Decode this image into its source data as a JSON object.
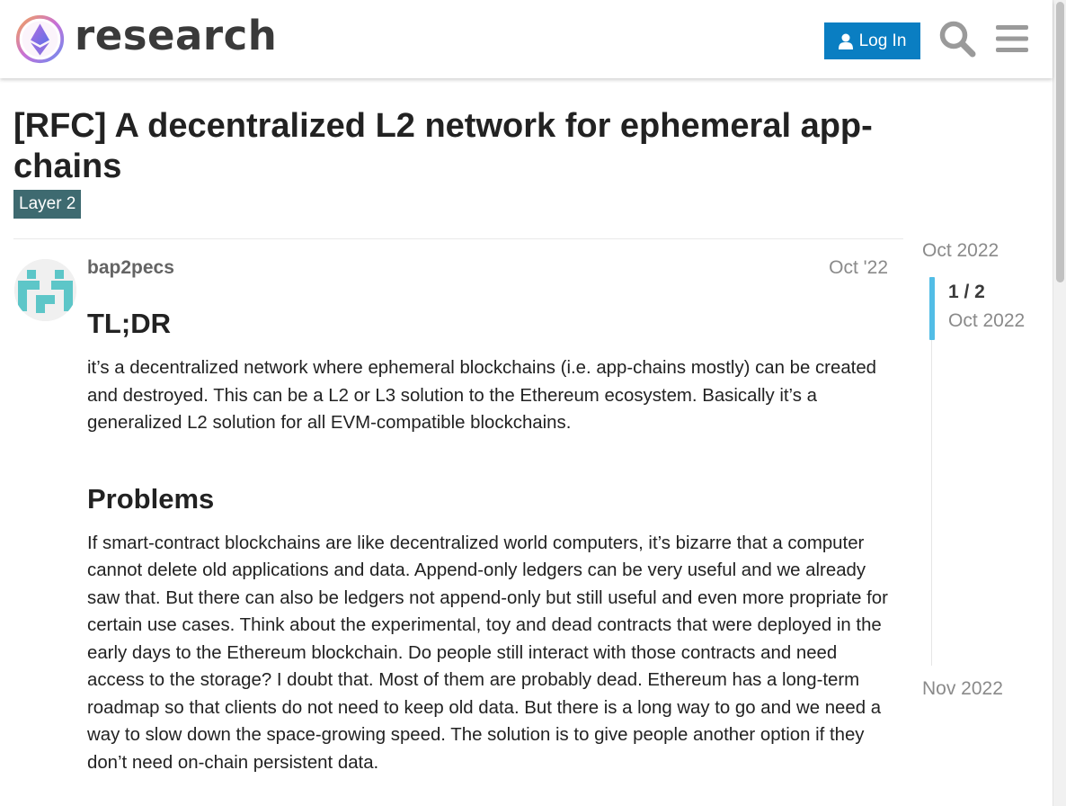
{
  "header": {
    "logo_text": "research",
    "login_label": "Log In",
    "icons": [
      "ethereum-logo",
      "user-icon",
      "search-icon",
      "hamburger-menu-icon"
    ],
    "accent_color": "#0a7ec2"
  },
  "topic": {
    "title": "[RFC] A decentralized L2 network for ephemeral app-chains",
    "category": "Layer 2",
    "category_color": "#3e6a70"
  },
  "post": {
    "author": "bap2pecs",
    "date": "Oct '22",
    "heading_tldr": "TL;DR",
    "tldr_text": "it’s a decentralized network where ephemeral blockchains (i.e. app-chains mostly) can be created and destroyed. This can be a L2 or L3 solution to the Ethereum ecosystem. Basically it’s a generalized L2 solution for all EVM-compatible blockchains.",
    "heading_problems": "Problems",
    "problems_text": "If smart-contract blockchains are like decentralized world computers, it’s bizarre that a computer cannot delete old applications and data. Append-only ledgers can be very useful and we already saw that. But there can also be ledgers not append-only but still useful and even more propriate for certain use cases. Think about the experimental, toy and dead contracts that were deployed in the early days to the Ethereum blockchain. Do people still interact with those contracts and need access to the storage? I doubt that. Most of them are probably dead. Ethereum has a long-term roadmap so that clients do not need to keep old data. But there is a long way to go and we need a way to slow down the space-growing speed. The solution is to give people another option if they don’t need on-chain persistent data."
  },
  "timeline": {
    "start": "Oct 2022",
    "position": "1 / 2",
    "current_date": "Oct 2022",
    "end": "Nov 2022"
  }
}
